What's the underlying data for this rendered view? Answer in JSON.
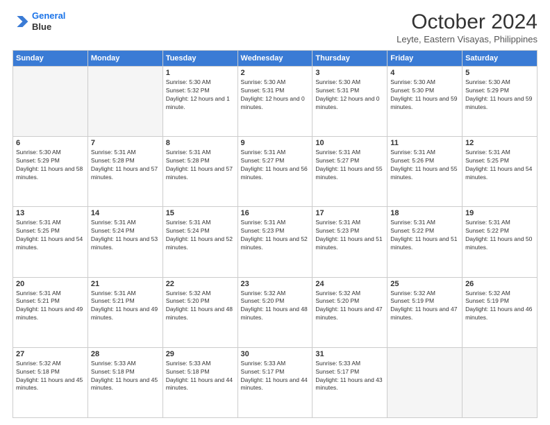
{
  "logo": {
    "line1": "General",
    "line2": "Blue"
  },
  "header": {
    "month": "October 2024",
    "location": "Leyte, Eastern Visayas, Philippines"
  },
  "weekdays": [
    "Sunday",
    "Monday",
    "Tuesday",
    "Wednesday",
    "Thursday",
    "Friday",
    "Saturday"
  ],
  "weeks": [
    [
      {
        "day": "",
        "sunrise": "",
        "sunset": "",
        "daylight": "",
        "empty": true
      },
      {
        "day": "",
        "sunrise": "",
        "sunset": "",
        "daylight": "",
        "empty": true
      },
      {
        "day": "1",
        "sunrise": "Sunrise: 5:30 AM",
        "sunset": "Sunset: 5:32 PM",
        "daylight": "Daylight: 12 hours and 1 minute.",
        "empty": false
      },
      {
        "day": "2",
        "sunrise": "Sunrise: 5:30 AM",
        "sunset": "Sunset: 5:31 PM",
        "daylight": "Daylight: 12 hours and 0 minutes.",
        "empty": false
      },
      {
        "day": "3",
        "sunrise": "Sunrise: 5:30 AM",
        "sunset": "Sunset: 5:31 PM",
        "daylight": "Daylight: 12 hours and 0 minutes.",
        "empty": false
      },
      {
        "day": "4",
        "sunrise": "Sunrise: 5:30 AM",
        "sunset": "Sunset: 5:30 PM",
        "daylight": "Daylight: 11 hours and 59 minutes.",
        "empty": false
      },
      {
        "day": "5",
        "sunrise": "Sunrise: 5:30 AM",
        "sunset": "Sunset: 5:29 PM",
        "daylight": "Daylight: 11 hours and 59 minutes.",
        "empty": false
      }
    ],
    [
      {
        "day": "6",
        "sunrise": "Sunrise: 5:30 AM",
        "sunset": "Sunset: 5:29 PM",
        "daylight": "Daylight: 11 hours and 58 minutes.",
        "empty": false
      },
      {
        "day": "7",
        "sunrise": "Sunrise: 5:31 AM",
        "sunset": "Sunset: 5:28 PM",
        "daylight": "Daylight: 11 hours and 57 minutes.",
        "empty": false
      },
      {
        "day": "8",
        "sunrise": "Sunrise: 5:31 AM",
        "sunset": "Sunset: 5:28 PM",
        "daylight": "Daylight: 11 hours and 57 minutes.",
        "empty": false
      },
      {
        "day": "9",
        "sunrise": "Sunrise: 5:31 AM",
        "sunset": "Sunset: 5:27 PM",
        "daylight": "Daylight: 11 hours and 56 minutes.",
        "empty": false
      },
      {
        "day": "10",
        "sunrise": "Sunrise: 5:31 AM",
        "sunset": "Sunset: 5:27 PM",
        "daylight": "Daylight: 11 hours and 55 minutes.",
        "empty": false
      },
      {
        "day": "11",
        "sunrise": "Sunrise: 5:31 AM",
        "sunset": "Sunset: 5:26 PM",
        "daylight": "Daylight: 11 hours and 55 minutes.",
        "empty": false
      },
      {
        "day": "12",
        "sunrise": "Sunrise: 5:31 AM",
        "sunset": "Sunset: 5:25 PM",
        "daylight": "Daylight: 11 hours and 54 minutes.",
        "empty": false
      }
    ],
    [
      {
        "day": "13",
        "sunrise": "Sunrise: 5:31 AM",
        "sunset": "Sunset: 5:25 PM",
        "daylight": "Daylight: 11 hours and 54 minutes.",
        "empty": false
      },
      {
        "day": "14",
        "sunrise": "Sunrise: 5:31 AM",
        "sunset": "Sunset: 5:24 PM",
        "daylight": "Daylight: 11 hours and 53 minutes.",
        "empty": false
      },
      {
        "day": "15",
        "sunrise": "Sunrise: 5:31 AM",
        "sunset": "Sunset: 5:24 PM",
        "daylight": "Daylight: 11 hours and 52 minutes.",
        "empty": false
      },
      {
        "day": "16",
        "sunrise": "Sunrise: 5:31 AM",
        "sunset": "Sunset: 5:23 PM",
        "daylight": "Daylight: 11 hours and 52 minutes.",
        "empty": false
      },
      {
        "day": "17",
        "sunrise": "Sunrise: 5:31 AM",
        "sunset": "Sunset: 5:23 PM",
        "daylight": "Daylight: 11 hours and 51 minutes.",
        "empty": false
      },
      {
        "day": "18",
        "sunrise": "Sunrise: 5:31 AM",
        "sunset": "Sunset: 5:22 PM",
        "daylight": "Daylight: 11 hours and 51 minutes.",
        "empty": false
      },
      {
        "day": "19",
        "sunrise": "Sunrise: 5:31 AM",
        "sunset": "Sunset: 5:22 PM",
        "daylight": "Daylight: 11 hours and 50 minutes.",
        "empty": false
      }
    ],
    [
      {
        "day": "20",
        "sunrise": "Sunrise: 5:31 AM",
        "sunset": "Sunset: 5:21 PM",
        "daylight": "Daylight: 11 hours and 49 minutes.",
        "empty": false
      },
      {
        "day": "21",
        "sunrise": "Sunrise: 5:31 AM",
        "sunset": "Sunset: 5:21 PM",
        "daylight": "Daylight: 11 hours and 49 minutes.",
        "empty": false
      },
      {
        "day": "22",
        "sunrise": "Sunrise: 5:32 AM",
        "sunset": "Sunset: 5:20 PM",
        "daylight": "Daylight: 11 hours and 48 minutes.",
        "empty": false
      },
      {
        "day": "23",
        "sunrise": "Sunrise: 5:32 AM",
        "sunset": "Sunset: 5:20 PM",
        "daylight": "Daylight: 11 hours and 48 minutes.",
        "empty": false
      },
      {
        "day": "24",
        "sunrise": "Sunrise: 5:32 AM",
        "sunset": "Sunset: 5:20 PM",
        "daylight": "Daylight: 11 hours and 47 minutes.",
        "empty": false
      },
      {
        "day": "25",
        "sunrise": "Sunrise: 5:32 AM",
        "sunset": "Sunset: 5:19 PM",
        "daylight": "Daylight: 11 hours and 47 minutes.",
        "empty": false
      },
      {
        "day": "26",
        "sunrise": "Sunrise: 5:32 AM",
        "sunset": "Sunset: 5:19 PM",
        "daylight": "Daylight: 11 hours and 46 minutes.",
        "empty": false
      }
    ],
    [
      {
        "day": "27",
        "sunrise": "Sunrise: 5:32 AM",
        "sunset": "Sunset: 5:18 PM",
        "daylight": "Daylight: 11 hours and 45 minutes.",
        "empty": false
      },
      {
        "day": "28",
        "sunrise": "Sunrise: 5:33 AM",
        "sunset": "Sunset: 5:18 PM",
        "daylight": "Daylight: 11 hours and 45 minutes.",
        "empty": false
      },
      {
        "day": "29",
        "sunrise": "Sunrise: 5:33 AM",
        "sunset": "Sunset: 5:18 PM",
        "daylight": "Daylight: 11 hours and 44 minutes.",
        "empty": false
      },
      {
        "day": "30",
        "sunrise": "Sunrise: 5:33 AM",
        "sunset": "Sunset: 5:17 PM",
        "daylight": "Daylight: 11 hours and 44 minutes.",
        "empty": false
      },
      {
        "day": "31",
        "sunrise": "Sunrise: 5:33 AM",
        "sunset": "Sunset: 5:17 PM",
        "daylight": "Daylight: 11 hours and 43 minutes.",
        "empty": false
      },
      {
        "day": "",
        "sunrise": "",
        "sunset": "",
        "daylight": "",
        "empty": true
      },
      {
        "day": "",
        "sunrise": "",
        "sunset": "",
        "daylight": "",
        "empty": true
      }
    ]
  ]
}
